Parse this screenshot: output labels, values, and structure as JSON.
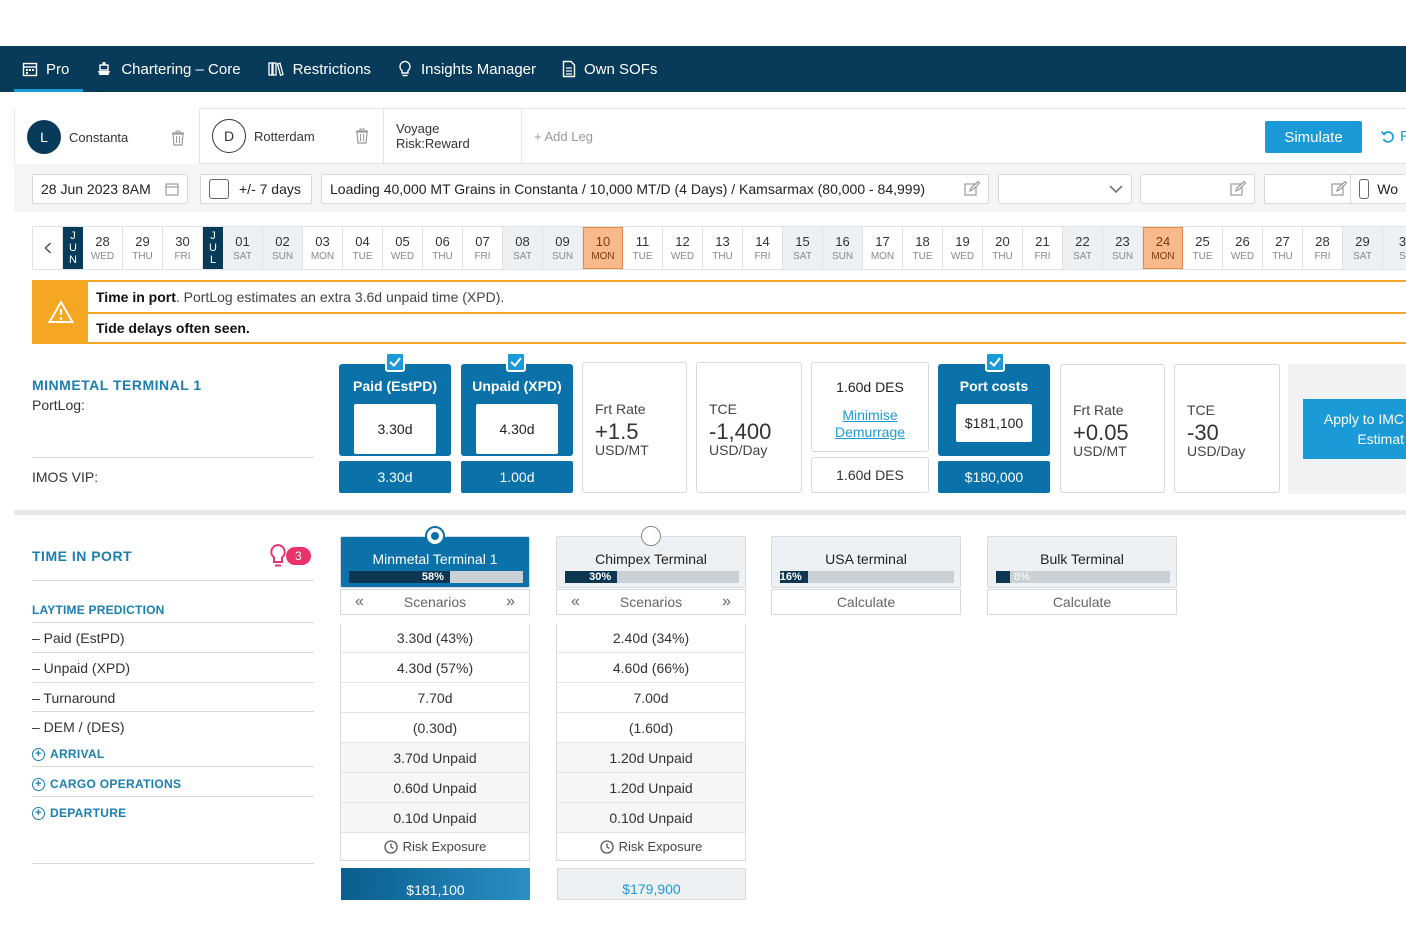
{
  "nav": {
    "items": [
      {
        "label": "Pro",
        "icon": "calendar-icon"
      },
      {
        "label": "Chartering – Core",
        "icon": "ship-icon"
      },
      {
        "label": "Restrictions",
        "icon": "books-icon"
      },
      {
        "label": "Insights Manager",
        "icon": "lightbulb-icon"
      },
      {
        "label": "Own SOFs",
        "icon": "document-icon"
      }
    ]
  },
  "legs": {
    "load": {
      "badge": "L",
      "port": "Constanta"
    },
    "discharge": {
      "badge": "D",
      "port": "Rotterdam"
    },
    "risk_reward": "Voyage Risk:Reward",
    "add_leg": "+ Add Leg",
    "simulate": "Simulate",
    "reset_partial": "R"
  },
  "controls": {
    "date": "28 Jun 2023 8AM",
    "flex": "+/- 7 days",
    "cargo": "Loading 40,000 MT Grains in Constanta / 10,000 MT/D (4 Days) / Kamsarmax (80,000 - 84,999)",
    "checkbox_label_partial": "Wo"
  },
  "calendar": {
    "days": [
      {
        "type": "month",
        "label": [
          "J",
          "U",
          "N"
        ]
      },
      {
        "n": "28",
        "w": "WED"
      },
      {
        "n": "29",
        "w": "THU"
      },
      {
        "n": "30",
        "w": "FRI"
      },
      {
        "type": "month",
        "label": [
          "J",
          "U",
          "L"
        ]
      },
      {
        "n": "01",
        "w": "SAT",
        "weekend": true
      },
      {
        "n": "02",
        "w": "SUN",
        "weekend": true
      },
      {
        "n": "03",
        "w": "MON"
      },
      {
        "n": "04",
        "w": "TUE"
      },
      {
        "n": "05",
        "w": "WED"
      },
      {
        "n": "06",
        "w": "THU"
      },
      {
        "n": "07",
        "w": "FRI"
      },
      {
        "n": "08",
        "w": "SAT",
        "weekend": true
      },
      {
        "n": "09",
        "w": "SUN",
        "weekend": true
      },
      {
        "n": "10",
        "w": "MON",
        "highlight": true
      },
      {
        "n": "11",
        "w": "TUE"
      },
      {
        "n": "12",
        "w": "WED"
      },
      {
        "n": "13",
        "w": "THU"
      },
      {
        "n": "14",
        "w": "FRI"
      },
      {
        "n": "15",
        "w": "SAT",
        "weekend": true
      },
      {
        "n": "16",
        "w": "SUN",
        "weekend": true
      },
      {
        "n": "17",
        "w": "MON"
      },
      {
        "n": "18",
        "w": "TUE"
      },
      {
        "n": "19",
        "w": "WED"
      },
      {
        "n": "20",
        "w": "THU"
      },
      {
        "n": "21",
        "w": "FRI"
      },
      {
        "n": "22",
        "w": "SAT",
        "weekend": true
      },
      {
        "n": "23",
        "w": "SUN",
        "weekend": true
      },
      {
        "n": "24",
        "w": "MON",
        "highlight": true
      },
      {
        "n": "25",
        "w": "TUE"
      },
      {
        "n": "26",
        "w": "WED"
      },
      {
        "n": "27",
        "w": "THU"
      },
      {
        "n": "28",
        "w": "FRI"
      },
      {
        "n": "29",
        "w": "SAT",
        "weekend": true
      },
      {
        "n": "3",
        "w": "S",
        "weekend": true
      }
    ]
  },
  "alert": {
    "line1_bold": "Time in port",
    "line1_rest": ". PortLog estimates an extra 3.6d unpaid time (XPD).",
    "line2": "Tide delays often seen."
  },
  "terminal_summary": {
    "title": "MINMETAL TERMINAL 1",
    "portlog_label": "PortLog:",
    "imos_label": "IMOS VIP:",
    "paid": {
      "title": "Paid (EstPD)",
      "portlog": "3.30d",
      "imos": "3.30d"
    },
    "unpaid": {
      "title": "Unpaid (XPD)",
      "portlog": "4.30d",
      "imos": "1.00d"
    },
    "frt_rate_1": {
      "label": "Frt Rate",
      "value": "+1.5",
      "unit": "USD/MT"
    },
    "tce_1": {
      "label": "TCE",
      "value": "-1,400",
      "unit": "USD/Day"
    },
    "des": {
      "top": "1.60d DES",
      "link_line1": "Minimise",
      "link_line2": "Demurrage",
      "bottom": "1.60d DES"
    },
    "port_costs": {
      "title": "Port costs",
      "portlog": "$181,100",
      "imos": "$180,000"
    },
    "frt_rate_2": {
      "label": "Frt Rate",
      "value": "+0.05",
      "unit": "USD/MT"
    },
    "tce_2": {
      "label": "TCE",
      "value": "-30",
      "unit": "USD/Day"
    },
    "apply_line1": "Apply to IMC",
    "apply_line2": "Estimat"
  },
  "time_in_port": {
    "title": "TIME IN PORT",
    "insights_count": "3",
    "laytime_title": "LAYTIME PREDICTION",
    "rows": [
      "– Paid (EstPD)",
      "– Unpaid (XPD)",
      "– Turnaround",
      "– DEM / (DES)"
    ],
    "expanders": [
      "ARRIVAL",
      "CARGO OPERATIONS",
      "DEPARTURE"
    ]
  },
  "terminals": [
    {
      "name": "Minmetal Terminal 1",
      "pct": 58,
      "pct_label": "58%",
      "footer": "Scenarios",
      "selected": true,
      "values": [
        "3.30d (43%)",
        "4.30d (57%)",
        "7.70d",
        "(0.30d)",
        "3.70d Unpaid",
        "0.60d Unpaid",
        "0.10d Unpaid"
      ],
      "risk": "Risk Exposure",
      "price": "$181,100"
    },
    {
      "name": "Chimpex Terminal",
      "pct": 30,
      "pct_label": "30%",
      "footer": "Scenarios",
      "selected": false,
      "values": [
        "2.40d (34%)",
        "4.60d (66%)",
        "7.00d",
        "(1.60d)",
        "1.20d Unpaid",
        "1.20d Unpaid",
        "0.10d Unpaid"
      ],
      "risk": "Risk Exposure",
      "price": "$179,900"
    },
    {
      "name": "USA terminal",
      "pct": 16,
      "pct_label": "16%",
      "footer": "Calculate"
    },
    {
      "name": "Bulk Terminal",
      "pct": 8,
      "pct_label": "8%",
      "footer": "Calculate"
    }
  ],
  "colors": {
    "navy": "#073b59",
    "accent": "#1a9ad6",
    "selected": "#0a72a8",
    "warning": "#f5a623",
    "highlight_day": "#f9b98a",
    "insight_pink": "#e8336d"
  }
}
